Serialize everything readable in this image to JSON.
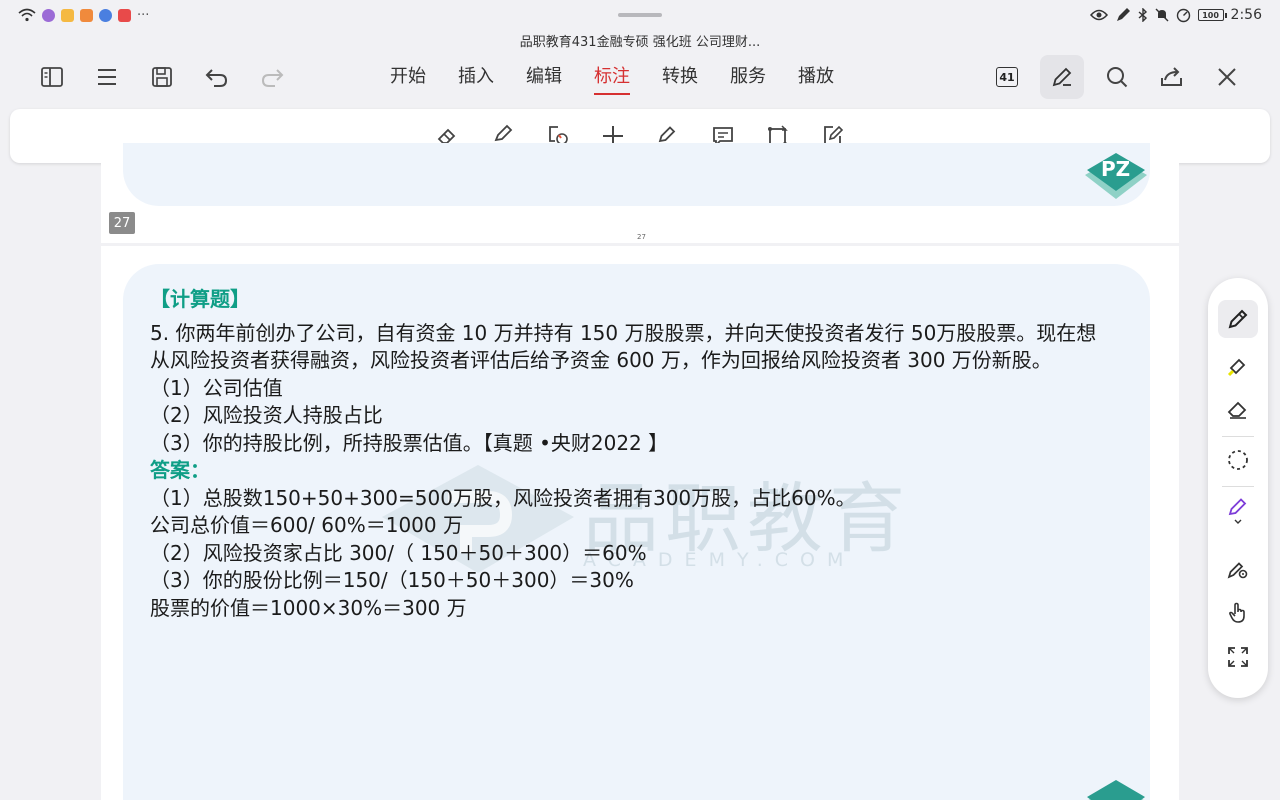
{
  "status_bar": {
    "time": "2:56",
    "battery": "100"
  },
  "document": {
    "title": "品职教育431金融专硕 强化班 公司理财..."
  },
  "toolbar": {
    "page_count": "41",
    "tabs": [
      {
        "label": "开始",
        "active": false
      },
      {
        "label": "插入",
        "active": false
      },
      {
        "label": "编辑",
        "active": false
      },
      {
        "label": "标注",
        "active": true
      },
      {
        "label": "转换",
        "active": false
      },
      {
        "label": "服务",
        "active": false
      },
      {
        "label": "播放",
        "active": false
      }
    ]
  },
  "pages": {
    "previous_page_number": "27",
    "previous_page_footer": "27",
    "logo_text": "PZ"
  },
  "watermark": {
    "cn": "品职教育",
    "en": "ACADEMY.COM"
  },
  "content": {
    "section_heading": "【计算题】",
    "question_line1": "5. 你两年前创办了公司，自有资金 10 万并持有 150 万股股票，并向天使投资者发行 50万股股票。现在想",
    "question_line2": "从风险投资者获得融资，风险投资者评估后给予资金 600 万，作为回报给风险投资者 300 万份新股。",
    "sub_q1": "（1）公司估值",
    "sub_q2": "（2）风险投资人持股占比",
    "sub_q3": "（3）你的持股比例，所持股票估值。【真题 •央财2022 】",
    "answer_heading": "答案：",
    "answer_line1": "（1）总股数150+50+300=500万股，风险投资者拥有300万股，占比60%。",
    "answer_line2": "公司总价值＝600/ 60%＝1000 万",
    "answer_line3": "（2）风险投资家占比 300/（ 150＋50＋300）＝60%",
    "answer_line4": "（3）你的股份比例＝150/（150＋50＋300）＝30%",
    "answer_line5": "股票的价值＝1000×30%＝300 万"
  },
  "colors": {
    "accent_red": "#d63031",
    "section_green": "#0f9e86",
    "card_bg": "#eef4fb",
    "logo_teal": "#2a9d8f"
  }
}
